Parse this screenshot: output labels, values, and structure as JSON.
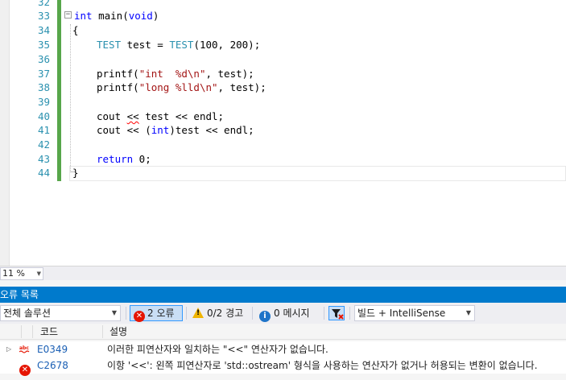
{
  "editor": {
    "line_numbers": [
      "32",
      "33",
      "34",
      "35",
      "36",
      "37",
      "38",
      "39",
      "40",
      "41",
      "42",
      "43",
      "44"
    ],
    "collapse_glyph": "−"
  },
  "zoom": {
    "value": "11 %"
  },
  "error_list": {
    "title": "오류 목록",
    "scope": "전체 솔루션",
    "errors_label": "2 오류",
    "warnings_label": "0/2 경고",
    "messages_label": "0 메시지",
    "build_filter": "빌드 + IntelliSense",
    "columns": {
      "code": "코드",
      "description": "설명"
    },
    "rows": [
      {
        "code": "E0349",
        "description": "이러한 피연산자와 일치하는 \"<<\" 연산자가 없습니다.",
        "icon": "intellisense-error-icon"
      },
      {
        "code": "C2678",
        "description": "이항 '<<': 왼쪽 피연산자로 'std::ostream' 형식을 사용하는 연산자가 없거나 허용되는 변환이 없습니다.",
        "icon": "error-icon"
      }
    ]
  },
  "colors": {
    "accent": "#007acc",
    "keyword": "#0000ff",
    "type": "#2b91af",
    "string": "#a31515",
    "change_bar": "#57a64a",
    "error": "#e51400"
  }
}
